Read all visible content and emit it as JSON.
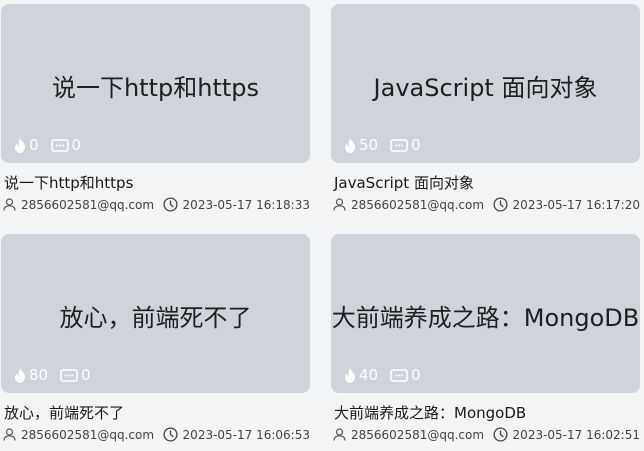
{
  "cards": [
    {
      "thumb_title": "说一下http和https",
      "likes": "0",
      "comments": "0",
      "title": "说一下http和https",
      "author": "2856602581@qq.com",
      "time": "2023-05-17 16:18:33"
    },
    {
      "thumb_title": "JavaScript 面向对象",
      "likes": "50",
      "comments": "0",
      "title": "JavaScript 面向对象",
      "author": "2856602581@qq.com",
      "time": "2023-05-17 16:17:20"
    },
    {
      "thumb_title": "放心，前端死不了",
      "likes": "80",
      "comments": "0",
      "title": "放心，前端死不了",
      "author": "2856602581@qq.com",
      "time": "2023-05-17 16:06:53"
    },
    {
      "thumb_title": "大前端养成之路：MongoDB",
      "likes": "40",
      "comments": "0",
      "title": "大前端养成之路：MongoDB",
      "author": "2856602581@qq.com",
      "time": "2023-05-17 16:02:51"
    }
  ],
  "icons": {
    "likes": "flame-icon",
    "comments": "comment-icon",
    "author": "user-icon",
    "time": "clock-icon"
  }
}
